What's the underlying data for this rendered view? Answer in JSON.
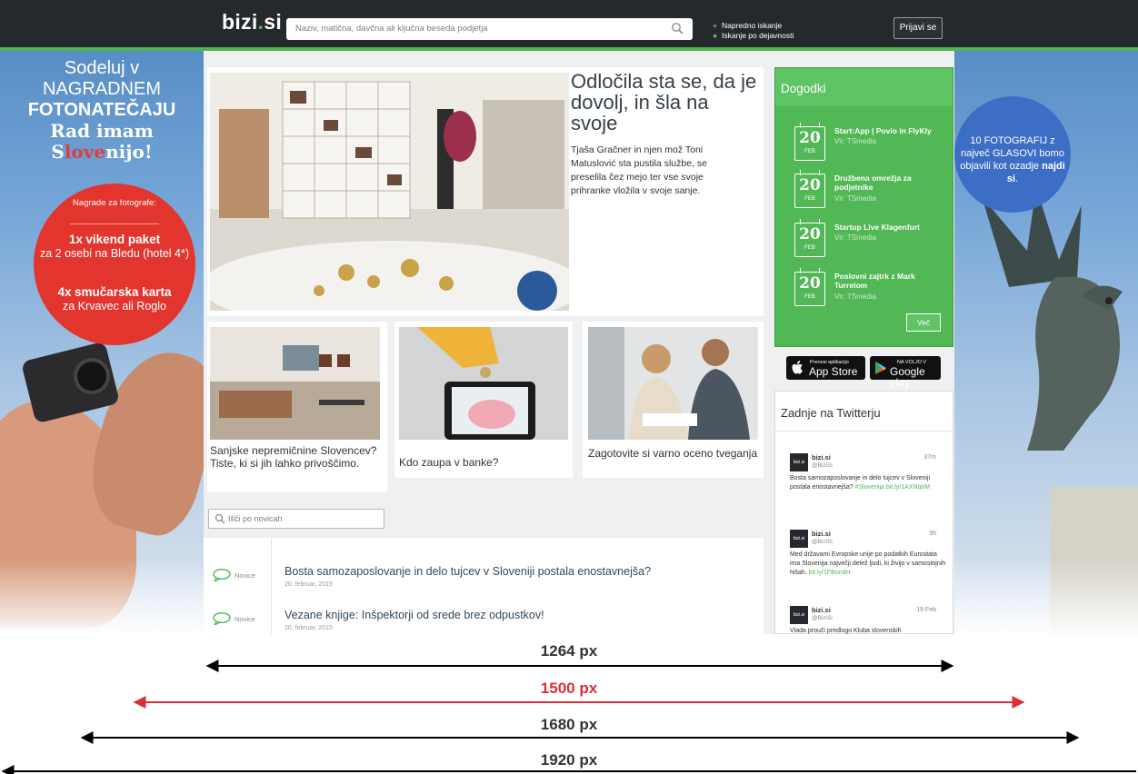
{
  "header": {
    "logo_main": "bizi",
    "logo_dot": ".",
    "logo_tld": "si",
    "search_placeholder": "Naziv, matična, davčna ali ključna beseda podjetja",
    "advanced_search": "Napredno iskanje",
    "activity_search": "Iskanje po dejavnosti",
    "login_label": "Prijavi se"
  },
  "left_promo": {
    "line1": "Sodeluj v",
    "line2": "NAGRADNEM",
    "line3": "FOTONATEČAJU",
    "line4": "Rad imam",
    "line5_prefix": "S",
    "line5_red": "love",
    "line5_suffix": "nijo!",
    "circle_heading": "Nagrade za fotografe:",
    "prize1_count": "1x",
    "prize1_bold": "vikend paket",
    "prize1_rest": "za 2 osebi na Bledu (hotel 4*)",
    "prize2_count": "4x",
    "prize2_bold": "smučarska karta",
    "prize2_rest": "za Krvavec ali Roglo"
  },
  "right_promo": {
    "text_a": "10 FOTOGRAFIJ z največ GLASOVI bomo objavili kot ozadje",
    "text_bold": "najdi si",
    "text_end": "."
  },
  "hero": {
    "title": "Odločila sta se, da je dovolj, in šla na svoje",
    "text": "Tjaša Gračner in njen mož Toni Matuslović sta pustila službe, se preselila čez mejo ter vse svoje prihranke vložila v svoje sanje."
  },
  "cards": [
    {
      "caption": "Sanjske nepremičnine Slovencev? Tiste, ki si jih lahko privoščimo."
    },
    {
      "caption": "Kdo zaupa v banke?"
    },
    {
      "caption": "Zagotovite si varno oceno tveganja"
    }
  ],
  "news_search_placeholder": "Išči po novicah",
  "news": [
    {
      "tag": "Novice",
      "title": "Bosta samozaposlovanje in delo tujcev v Sloveniji postala enostavnejša?",
      "date": "20. februar, 2015"
    },
    {
      "tag": "Novice",
      "title": "Vezane knjige: Inšpektorji od srede brez odpustkov!",
      "date": "20. februar, 2015"
    }
  ],
  "events": {
    "heading": "Dogodki",
    "items": [
      {
        "day": "20",
        "month": "FEB",
        "title": "Start:App | Povio in FlyKly",
        "source": "Vir: TSmedia"
      },
      {
        "day": "20",
        "month": "FEB",
        "title": "Družbena omrežja za podjetnike",
        "source": "Vir: TSmedia"
      },
      {
        "day": "20",
        "month": "FEB",
        "title": "Startup Live Klagenfurt",
        "source": "Vir: TSmedia"
      },
      {
        "day": "20",
        "month": "FEB",
        "title": "Poslovni zajtrk z Mark Turrelom",
        "source": "Vir: TSmedia"
      }
    ],
    "more_label": "Več"
  },
  "badges": {
    "appstore_small": "Prenesi aplikacijo",
    "appstore_big": "App Store",
    "gplay_small": "NA VOLJO V",
    "gplay_big": "Google play"
  },
  "twitter": {
    "heading": "Zadnje na Twitterju",
    "tweets": [
      {
        "avatar": "bizi.si",
        "name": "bizi.si",
        "handle": "@BiziSi",
        "time": "37m",
        "text": "Bosta samozaposlovanje in delo tujcev v Sloveniji postala enostavnejša?",
        "links": "#Slovenija bit.ly/1AXNqoM"
      },
      {
        "avatar": "bizi.si",
        "name": "bizi.si",
        "handle": "@BiziSi",
        "time": "5h",
        "text": "Med državami Evropske unije po podatkih Eurostata ima Slovenija največji delež ljudi, ki živijo v samostojnih hišah.",
        "links": "bit.ly/1FBondH"
      },
      {
        "avatar": "bizi.si",
        "name": "bizi.si",
        "handle": "@BiziSi",
        "time": "19 Feb",
        "text": "Vlada prouči predlogo Kluba slovenskih",
        "links": ""
      }
    ]
  },
  "dimensions": [
    {
      "label": "1264 px",
      "color": "#000000"
    },
    {
      "label": "1500 px",
      "color": "#d9303a"
    },
    {
      "label": "1680 px",
      "color": "#000000"
    },
    {
      "label": "1920 px",
      "color": "#000000"
    }
  ]
}
